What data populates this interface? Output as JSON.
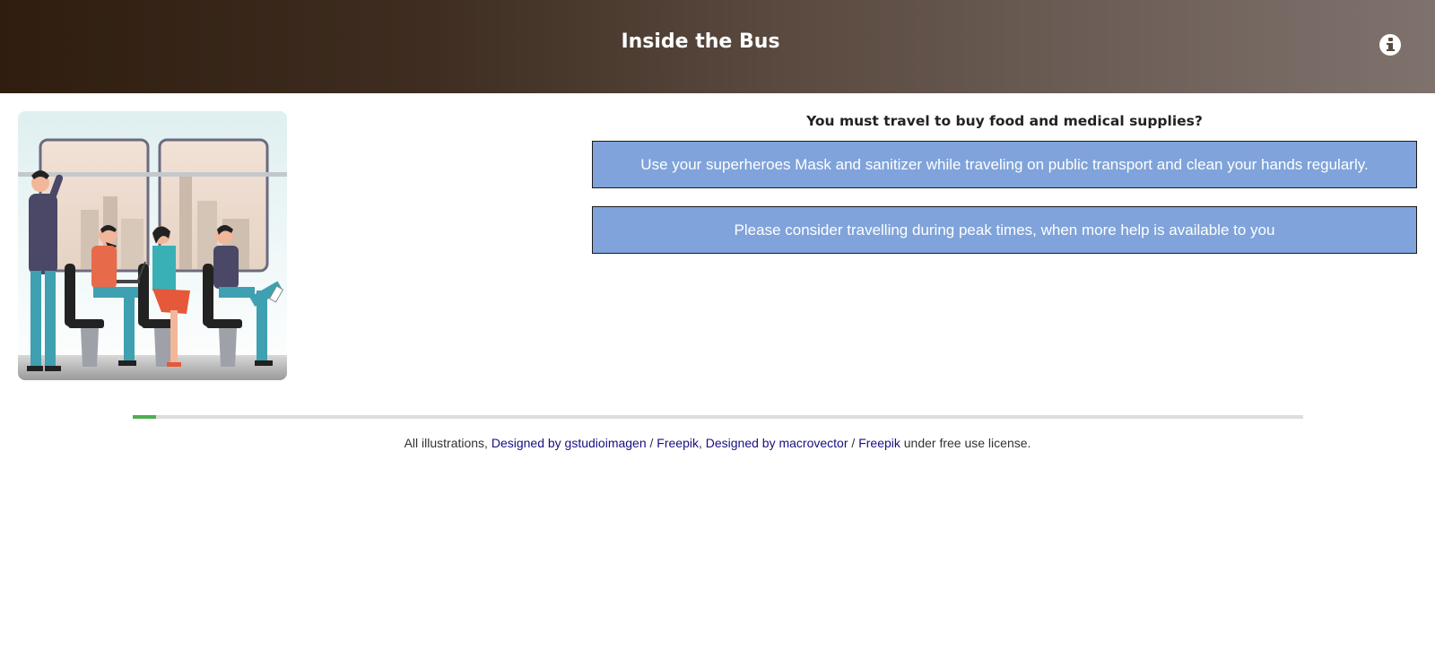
{
  "header": {
    "title": "Inside the Bus",
    "info_icon": "info-circle-icon"
  },
  "illustration": {
    "icon": "bus-passengers-illustration"
  },
  "question": {
    "text": "You must travel to buy food and medical supplies?"
  },
  "answers": [
    {
      "label": "Use your superheroes Mask and sanitizer while traveling on public transport and clean your hands regularly."
    },
    {
      "label": "Please consider travelling during peak times, when more help is available to you"
    }
  ],
  "progress": {
    "fraction": 0.02,
    "fill_color": "#4caf50",
    "track_color": "#dddddd"
  },
  "credits": {
    "prefix": "All illustrations, ",
    "link1": "Designed by gstudioimagen",
    "sep1": " / ",
    "link2": "Freepik",
    "comma": ", ",
    "link3": "Designed by macrovector",
    "sep2": " / ",
    "link4": "Freepik",
    "suffix": " under free use license."
  },
  "colors": {
    "answer_bg": "#7fa3da",
    "link": "#1a0f80"
  }
}
